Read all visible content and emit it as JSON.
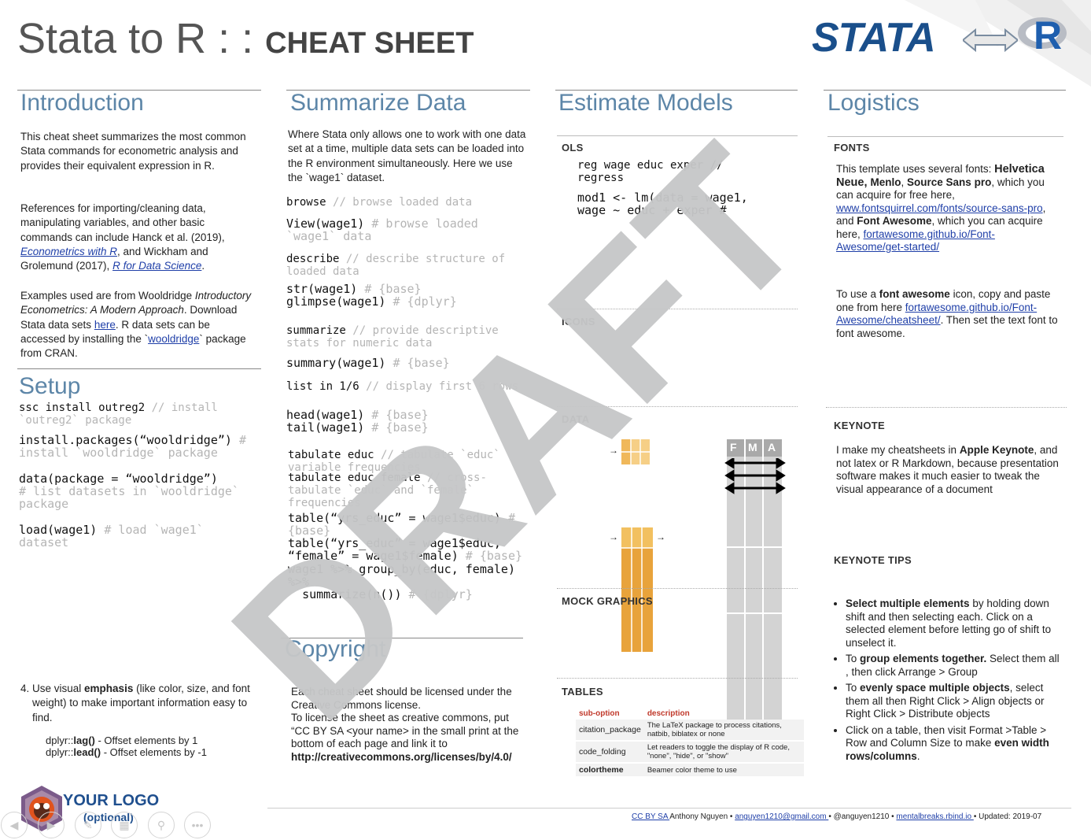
{
  "header": {
    "title_light": "Stata to R : : ",
    "title_bold": "CHEAT SHEET",
    "logo_left": "STATA",
    "logo_right": "R"
  },
  "introduction": {
    "heading": "Introduction",
    "p1": "This cheat sheet summarizes the most common Stata commands for econometric analysis and provides their equivalent expression in R.",
    "p2a": "References for importing/cleaning data, manipulating variables, and other basic commands can include Hanck et al. (2019), ",
    "p2_link1": "Econometrics with R",
    "p2b": ", and Wickham and Grolemund (2017), ",
    "p2_link2": "R for Data Science",
    "p2c": ".",
    "p3a": "Examples used are from Wooldridge ",
    "p3_italic": "Introductory Econometrics: A Modern Approach",
    "p3b": ". Download Stata data sets ",
    "p3_link_here": "here",
    "p3c": ". R data sets can be accessed by installing the `",
    "p3_link_pkg": "wooldridge",
    "p3d": "` package from CRAN."
  },
  "setup": {
    "heading": "Setup",
    "l1_code": "ssc install outreg2 ",
    "l1_comment": "// install `outreg2` package",
    "l2_code": "install.packages(“wooldridge”) ",
    "l2_comment": "# install `wooldridge` package",
    "l3_code": "data(package = “wooldridge”)",
    "l3_comment": "# list datasets in `wooldridge` package",
    "l4_code": "load(wage1) ",
    "l4_comment": "# load `wage1` dataset"
  },
  "emphasis": {
    "item": "4. Use visual ",
    "item_bold": "emphasis",
    "item_rest": " (like color, size, and font weight) to make important information easy to find.",
    "d1_pre": "dplyr::",
    "d1_bold": "lag()",
    "d1_post": " - Offset elements by 1",
    "d2_pre": "dplyr::",
    "d2_bold": "lead()",
    "d2_post": " - Offset elements by -1"
  },
  "logo": {
    "text": "YOUR LOGO",
    "optional": "(optional)"
  },
  "summarize": {
    "heading": "Summarize Data",
    "intro": "Where Stata only allows one to work with one data set at a time, multiple data sets can be loaded into the R environment simultaneously. Here we  use the `wage1` dataset.",
    "b1_code": "browse ",
    "b1_comment": "// browse loaded data",
    "b2_code": "View(wage1) ",
    "b2_comment": "# browse loaded `wage1` data",
    "b3_code": "describe ",
    "b3_comment": "// describe structure of loaded data",
    "b4_code1": "str(wage1) ",
    "b4_comment1": "# {base}",
    "b4_code2": "glimpse(wage1) ",
    "b4_comment2": "# {dplyr}",
    "b5_code": "summarize ",
    "b5_comment": "// provide descriptive stats for numeric data",
    "b6_code": "summary(wage1) ",
    "b6_comment": "# {base}",
    "b7_code": "list in 1/6 ",
    "b7_comment": "// display first 6 rows",
    "b8_code1": "head(wage1) ",
    "b8_comment1": "# {base}",
    "b8_code2": "tail(wage1) ",
    "b8_comment2": "# {base}",
    "b9_code": "tabulate educ ",
    "b9_comment": "// tabulate `educ` variable frequencies",
    "b10_code": "tabulate educ female ",
    "b10_comment": "// cross-tabulate `educ` and `female` frequencies",
    "b11_code": "table(“yrs_educ” = wage1$educ) ",
    "b11_comment": "# {base}",
    "b12_code": "table(“yrs_educ” = wage1$educ,\n“female” = wage1$female) ",
    "b12_comment": "# {base}",
    "b13_code": "wage1 %>% group_by(educ, female) %>%\n  summarize(n()) ",
    "b13_comment": "# {dplyr}"
  },
  "copyright": {
    "heading": "Copyright",
    "p1": "Each cheat sheet should be licensed under the Creative Commons license.",
    "p2": "To license the sheet as creative commons, put “CC BY SA <your name> in the small print at the bottom of each page and link it to",
    "link": "http://creativecommons.org/licenses/by/4.0/"
  },
  "estimate": {
    "heading": "Estimate Models",
    "ols_label": "OLS",
    "ols_stata": "reg wage educ exper //\nregress",
    "ols_r": "mod1 <- lm(data = wage1,\nwage ~ educ + exper #",
    "icons_label": "ICONS",
    "data_label": "DATA",
    "graph_label": "MOCK GRAPHICS",
    "fma": [
      "F",
      "M",
      "A"
    ],
    "tables_label": "TABLES",
    "table_headers": [
      "sub-option",
      "description"
    ],
    "table_rows": [
      [
        "citation_package",
        "The LaTeX package to process citations, natbib, biblatex or none"
      ],
      [
        "code_folding",
        "Let readers to toggle the display of R code, \"none\", \"hide\", or \"show\""
      ],
      [
        "colortheme",
        "Beamer color theme to use"
      ]
    ]
  },
  "logistics": {
    "heading": "Logistics",
    "fonts_label": "FONTS",
    "fonts_p1a": "This template uses several fonts: ",
    "fonts_b1": "Helvetica Neue, ",
    "fonts_b2": "Menlo",
    "fonts_sep": ", ",
    "fonts_b3": "Source Sans pro",
    "fonts_p1b": ", which you can acquire for free here, ",
    "fonts_link1": "www.fontsquirrel.com/fonts/source-sans-pro",
    "fonts_p1c": ", and ",
    "fonts_b4": "Font Awesome",
    "fonts_p1d": ", which you can acquire here, ",
    "fonts_link2": "fortawesome.github.io/Font-Awesome/get-started/",
    "fonts_p2a": "To use a ",
    "fonts_p2b": "font awesome",
    "fonts_p2c": " icon, copy and paste one from here ",
    "fonts_link3": "fortawesome.github.io/Font-Awesome/cheatsheet/",
    "fonts_p2d": ". Then set the text font to font awesome.",
    "keynote_label": "KEYNOTE",
    "keynote_a": "I make my cheatsheets in ",
    "keynote_b": "Apple Keynote",
    "keynote_c": ", and not latex or R Markdown, because presentation software makes it much easier to tweak the visual appearance of a document",
    "tips_label": "KEYNOTE TIPS",
    "tips": [
      {
        "bold": "Select multiple elements",
        "rest": " by holding down shift and then selecting each. Click on a selected element before letting go of shift to unselect it."
      },
      {
        "pre": "To ",
        "bold": "group elements together.",
        "rest": " Select them all , then click Arrange > Group"
      },
      {
        "pre": "To ",
        "bold": "evenly space multiple objects",
        "rest": ", select them all then Right Click > Align objects or Right Click > Distribute objects"
      },
      {
        "pre": "Click on a table, then visit Format >Table > Row and Column Size to make ",
        "bold": "even width rows/columns",
        "rest": "."
      }
    ]
  },
  "footer": {
    "cc": "CC BY SA ",
    "author": "Anthony Nguyen • ",
    "email": "anguyen1210@gmail.com ",
    "handle": " • @anguyen1210 • ",
    "site": "mentalbreaks.rbind.io ",
    "updated": "• Updated: 2019-07"
  },
  "watermark": "DRAFT",
  "colors": {
    "heading": "#5d86a8",
    "stata_blue": "#1a4f8b",
    "data_orange": "#e8a33b",
    "watermark": "#c6c7c8"
  }
}
